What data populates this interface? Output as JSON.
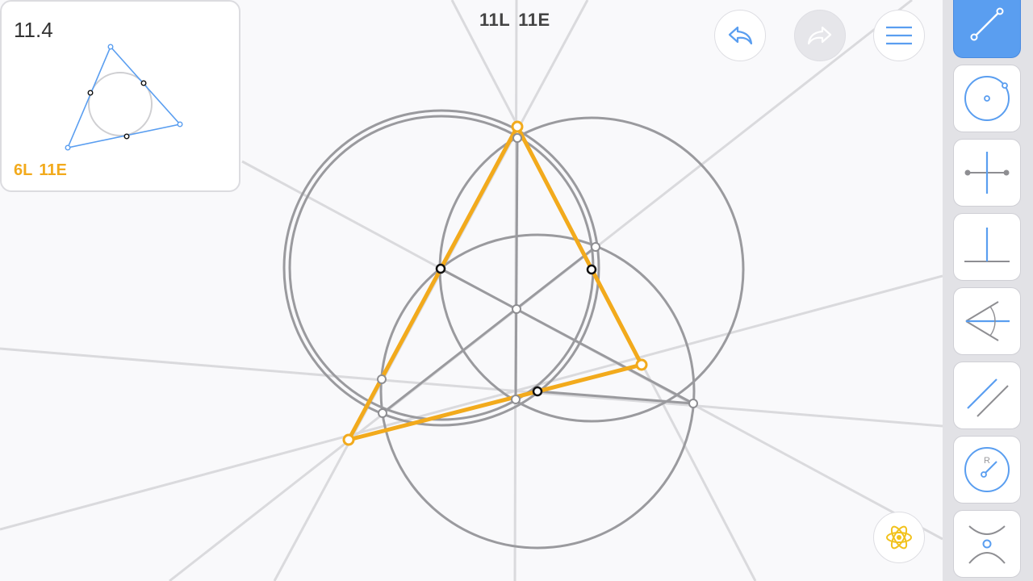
{
  "level": {
    "id": "11.4",
    "goal_lines": "6L",
    "goal_elements": "11E"
  },
  "counter": {
    "lines": "11L",
    "elements": "11E"
  },
  "buttons": {
    "undo": "undo-icon",
    "redo": "redo-icon",
    "menu": "menu-icon",
    "hint": "atom-icon"
  },
  "tools": [
    {
      "name": "line",
      "icon": "segment-icon",
      "active": true
    },
    {
      "name": "circle",
      "icon": "circle-icon",
      "active": false
    },
    {
      "name": "perpendicular-bisector",
      "icon": "bisector-icon",
      "active": false
    },
    {
      "name": "perpendicular",
      "icon": "perpendicular-icon",
      "active": false
    },
    {
      "name": "angle-bisector",
      "icon": "angle-bisector-icon",
      "active": false
    },
    {
      "name": "parallel",
      "icon": "parallel-icon",
      "active": false
    },
    {
      "name": "compass",
      "icon": "compass-icon",
      "label": "R",
      "active": false
    },
    {
      "name": "intersection",
      "icon": "intersection-icon",
      "active": false
    }
  ],
  "colors": {
    "accent": "#f2aa1c",
    "construction": "#9a9a9e",
    "guide": "#d8d8db",
    "tool_blue": "#5a9ef0",
    "background": "#f9f9fb"
  }
}
